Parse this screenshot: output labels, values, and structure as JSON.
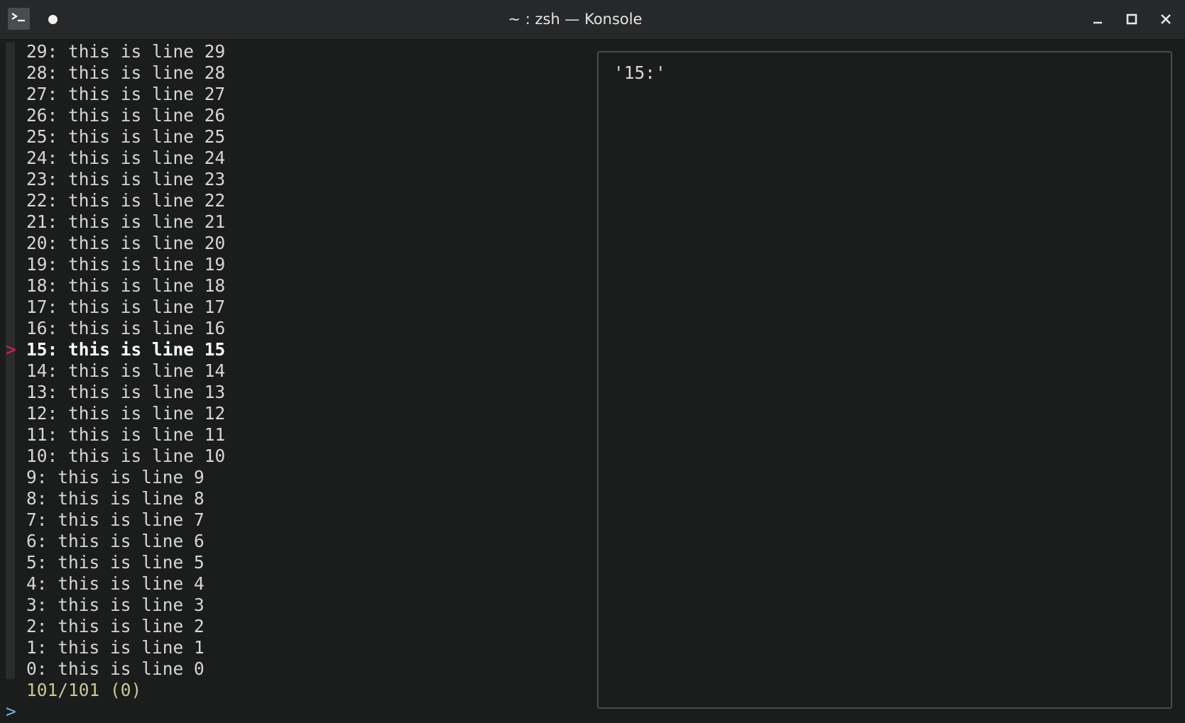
{
  "window": {
    "title": "~ : zsh — Konsole",
    "icons": {
      "app": "terminal-icon",
      "record": "record-dot-icon",
      "minimize": "minimize-icon",
      "maximize": "maximize-icon",
      "close": "close-icon"
    }
  },
  "terminal": {
    "lines": [
      "29: this is line 29",
      "28: this is line 28",
      "27: this is line 27",
      "26: this is line 26",
      "25: this is line 25",
      "24: this is line 24",
      "23: this is line 23",
      "22: this is line 22",
      "21: this is line 21",
      "20: this is line 20",
      "19: this is line 19",
      "18: this is line 18",
      "17: this is line 17",
      "16: this is line 16",
      "15: this is line 15",
      "14: this is line 14",
      "13: this is line 13",
      "12: this is line 12",
      "11: this is line 11",
      "10: this is line 10",
      "9: this is line 9",
      "8: this is line 8",
      "7: this is line 7",
      "6: this is line 6",
      "5: this is line 5",
      "4: this is line 4",
      "3: this is line 3",
      "2: this is line 2",
      "1: this is line 1",
      "0: this is line 0"
    ],
    "selected_index": 14,
    "pointer": ">",
    "match_count": "101/101 (0)",
    "prompt": ">",
    "preview": "'15:'"
  },
  "colors": {
    "background": "#1b1c1c",
    "titlebar": "#272829",
    "text": "#d6d6d4",
    "pointer": "#e8175d",
    "count": "#c8c891",
    "prompt": "#6fb3e8",
    "border": "#4a4b4c"
  }
}
